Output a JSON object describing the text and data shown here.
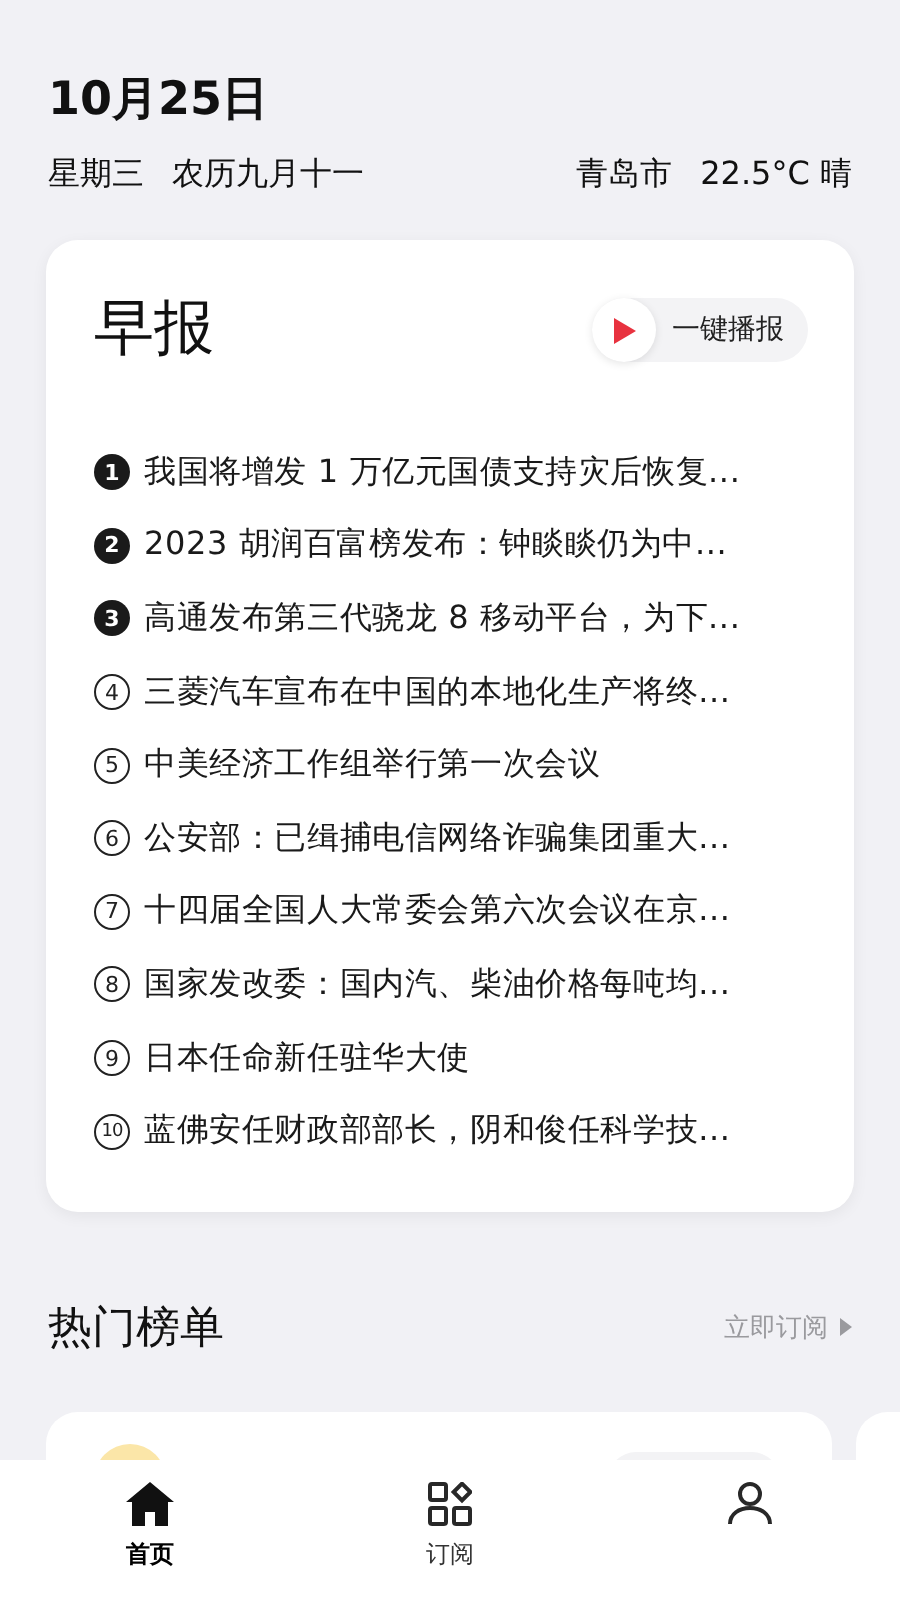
{
  "header": {
    "date": "10月25日",
    "weekday": "星期三",
    "lunar": "农历九月十一",
    "city": "青岛市",
    "weather": "22.5°C 晴"
  },
  "briefing": {
    "title": "早报",
    "play_button": "一键播报",
    "items": [
      {
        "rank": "1",
        "highlight": true,
        "text": "我国将增发 1 万亿元国债支持灾后恢复..."
      },
      {
        "rank": "2",
        "highlight": true,
        "text": "2023 胡润百富榜发布：钟睒睒仍为中..."
      },
      {
        "rank": "3",
        "highlight": true,
        "text": "高通发布第三代骁龙 8 移动平台，为下..."
      },
      {
        "rank": "4",
        "highlight": false,
        "text": "三菱汽车宣布在中国的本地化生产将终..."
      },
      {
        "rank": "5",
        "highlight": false,
        "text": "中美经济工作组举行第一次会议"
      },
      {
        "rank": "6",
        "highlight": false,
        "text": "公安部：已缉捕电信网络诈骗集团重大..."
      },
      {
        "rank": "7",
        "highlight": false,
        "text": "十四届全国人大常委会第六次会议在京..."
      },
      {
        "rank": "8",
        "highlight": false,
        "text": "国家发改委：国内汽、柴油价格每吨均..."
      },
      {
        "rank": "9",
        "highlight": false,
        "text": "日本任命新任驻华大使"
      },
      {
        "rank": "10",
        "highlight": false,
        "text": "蓝佛安任财政部部长，阴和俊任科学技..."
      }
    ]
  },
  "hot_list": {
    "title": "热门榜单",
    "subscribe_link": "立即订阅"
  },
  "bottom_nav": [
    {
      "kind": "home",
      "label": "首页",
      "selected": true
    },
    {
      "kind": "subscribe",
      "label": "订阅",
      "selected": false
    },
    {
      "kind": "profile",
      "selected": false
    }
  ]
}
